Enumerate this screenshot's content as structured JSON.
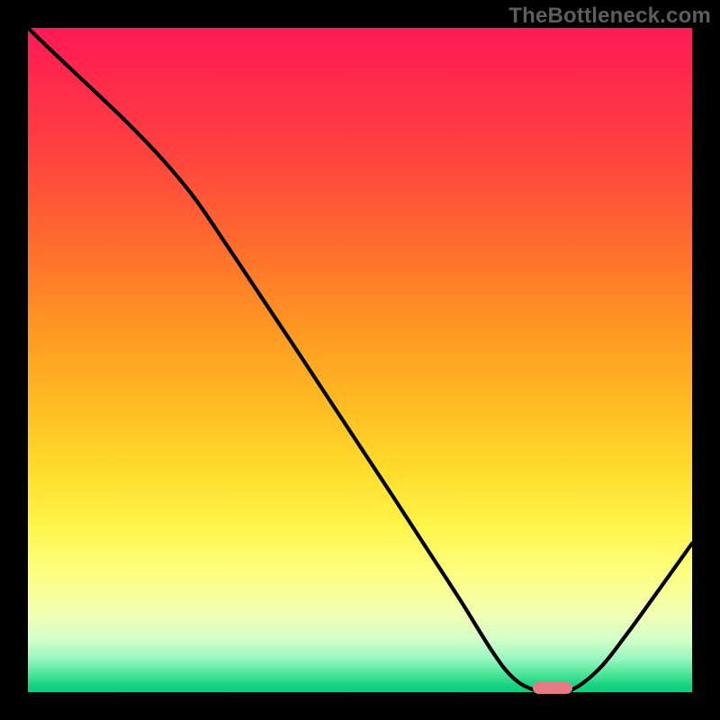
{
  "watermark": "TheBottleneck.com",
  "chart_data": {
    "type": "line",
    "title": "",
    "xlabel": "",
    "ylabel": "",
    "xlim": [
      0,
      100
    ],
    "ylim": [
      0,
      100
    ],
    "x": [
      0,
      5,
      10,
      15,
      20,
      25,
      30,
      35,
      40,
      45,
      50,
      55,
      60,
      65,
      70,
      73,
      76,
      79,
      82,
      86,
      90,
      95,
      100
    ],
    "values": [
      100,
      95.2,
      90.5,
      85.7,
      80.5,
      74.5,
      67.2,
      59.7,
      52.2,
      44.6,
      37.0,
      29.4,
      21.7,
      14.0,
      6.0,
      2.2,
      0.4,
      0.0,
      0.4,
      3.5,
      8.5,
      15.4,
      22.4
    ],
    "minimum_marker": {
      "x_start": 76,
      "x_end": 82,
      "y": 0
    },
    "background_gradient": {
      "top": "#ff1a55",
      "mid": "#ffd22a",
      "bottom": "#0fcf80"
    }
  }
}
